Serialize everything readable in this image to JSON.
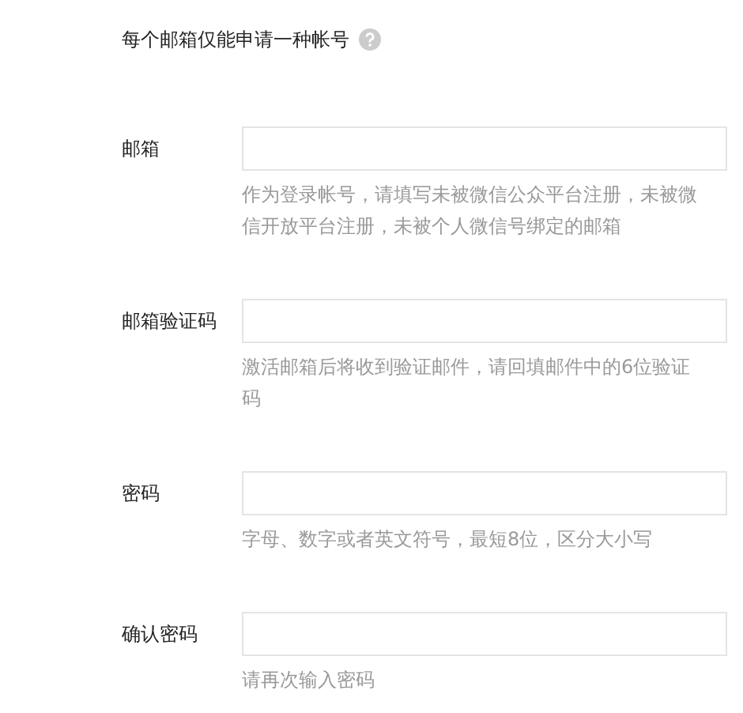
{
  "notice": {
    "text": "每个邮箱仅能申请一种帐号"
  },
  "fields": [
    {
      "label": "邮箱",
      "hint": "作为登录帐号，请填写未被微信公众平台注册，未被微信开放平台注册，未被个人微信号绑定的邮箱"
    },
    {
      "label": "邮箱验证码",
      "hint": "激活邮箱后将收到验证邮件，请回填邮件中的6位验证码"
    },
    {
      "label": "密码",
      "hint": "字母、数字或者英文符号，最短8位，区分大小写"
    },
    {
      "label": "确认密码",
      "hint": "请再次输入密码"
    }
  ]
}
